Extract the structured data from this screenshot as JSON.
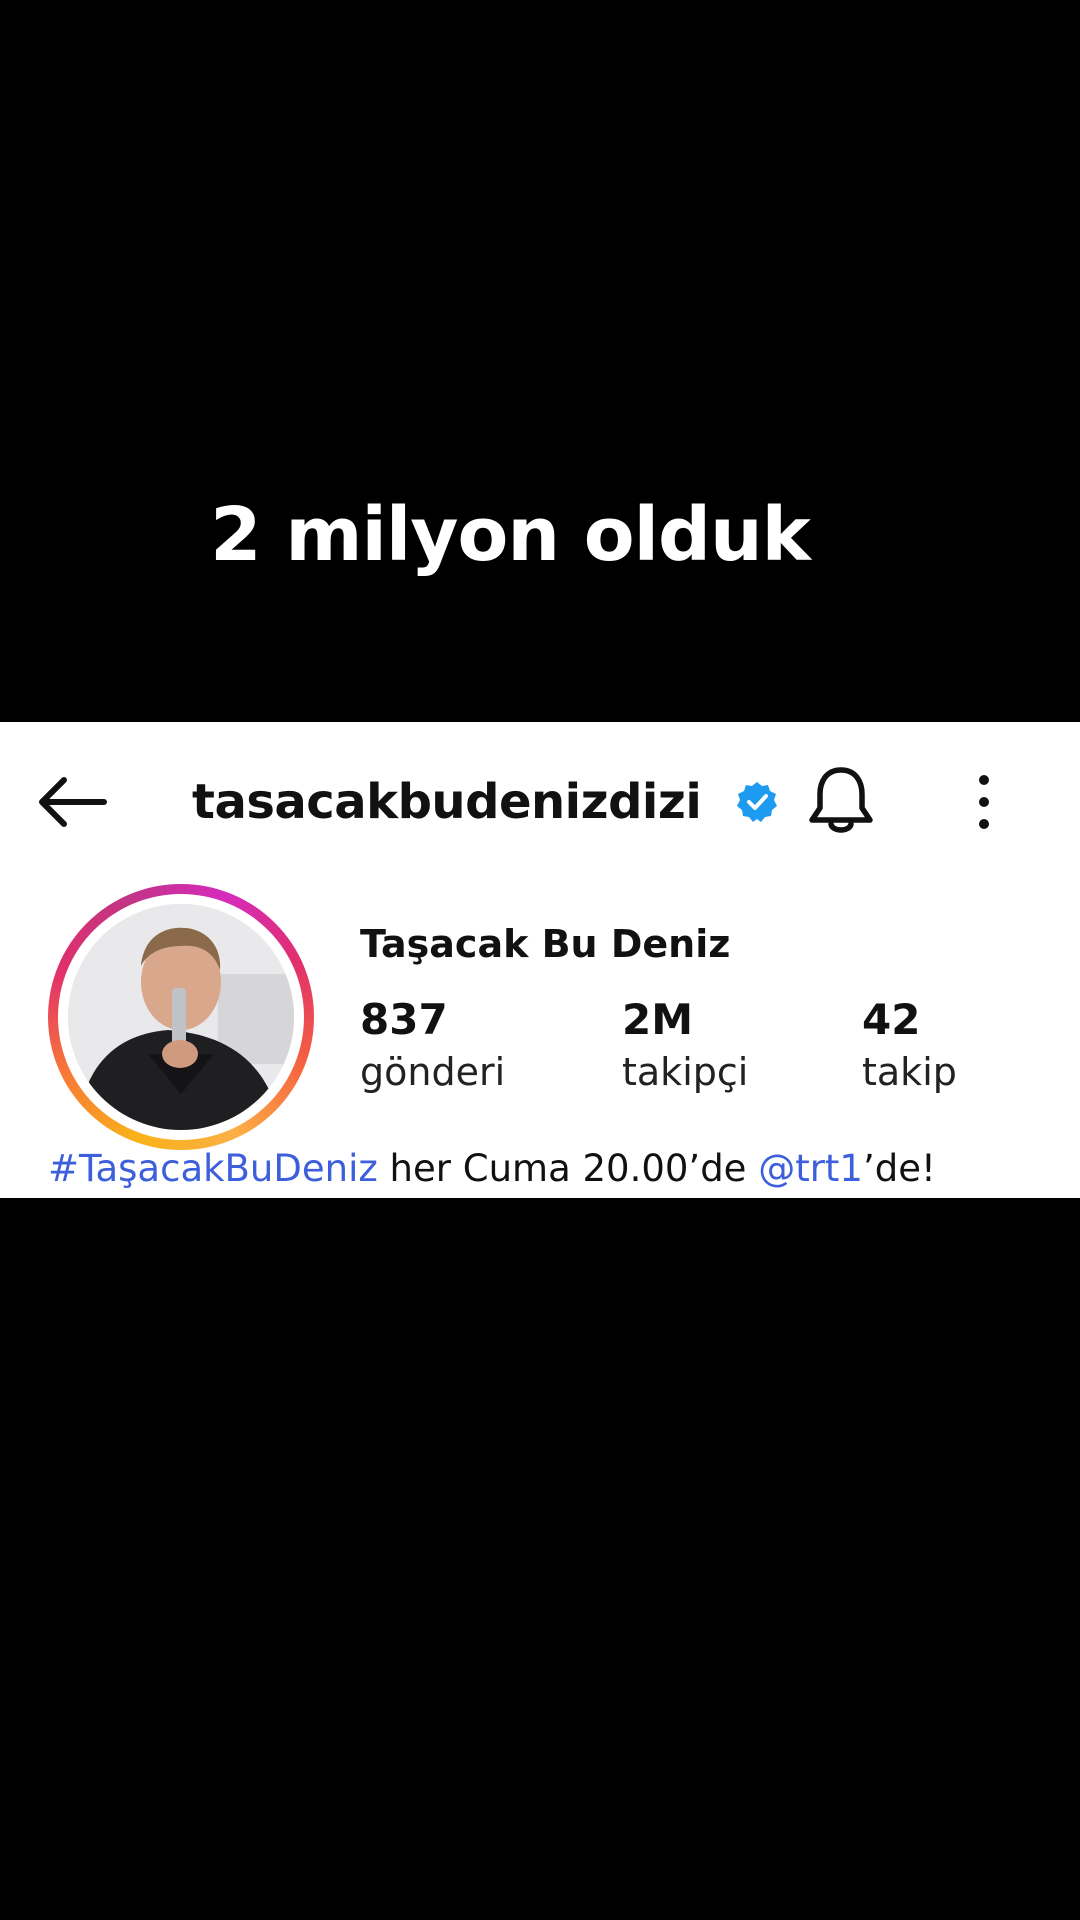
{
  "caption": {
    "text": "2 milyon olduk"
  },
  "header": {
    "username": "tasacakbudenizdizi",
    "icons": {
      "back": "arrow-left-icon",
      "verified": "verified-badge-icon",
      "notifications": "bell-icon",
      "more": "more-vertical-icon"
    }
  },
  "profile": {
    "display_name": "Taşacak Bu Deniz",
    "avatar": "profile-photo-with-story-ring",
    "stats": {
      "posts": {
        "value": "837",
        "label": "gönderi"
      },
      "followers": {
        "value": "2M",
        "label": "takipçi"
      },
      "following": {
        "value": "42",
        "label": "takip"
      }
    },
    "bio": {
      "hashtag": "#TaşacakBuDeniz",
      "text_middle": " her Cuma 20.00’de ",
      "mention": "@trt1",
      "text_end": "’de!"
    }
  },
  "colors": {
    "link": "#3d5fdb",
    "verified": "#1d9bf0",
    "background": "#000000",
    "card": "#ffffff"
  }
}
